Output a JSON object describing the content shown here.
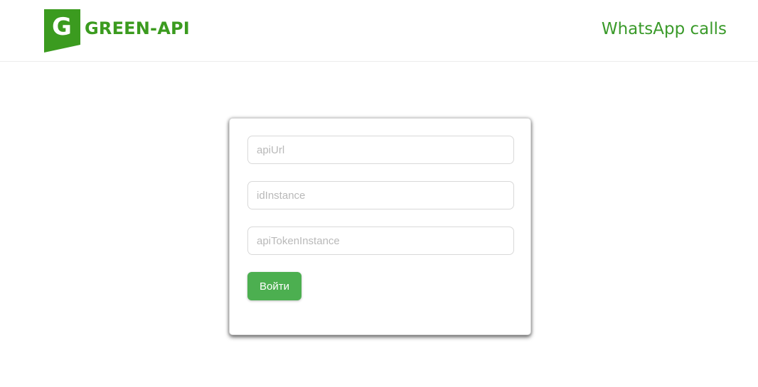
{
  "header": {
    "logo_text": "GREEN-API",
    "logo_icon": "green-api-g-logo-icon",
    "title": "WhatsApp calls"
  },
  "login_form": {
    "api_url": {
      "placeholder": "apiUrl",
      "value": ""
    },
    "id_instance": {
      "placeholder": "idInstance",
      "value": ""
    },
    "api_token_instance": {
      "placeholder": "apiTokenInstance",
      "value": ""
    },
    "submit_label": "Войти"
  },
  "colors": {
    "brand_green": "#3b9b1f",
    "button_green": "#4caf50",
    "title_green": "#3a9a2a"
  }
}
